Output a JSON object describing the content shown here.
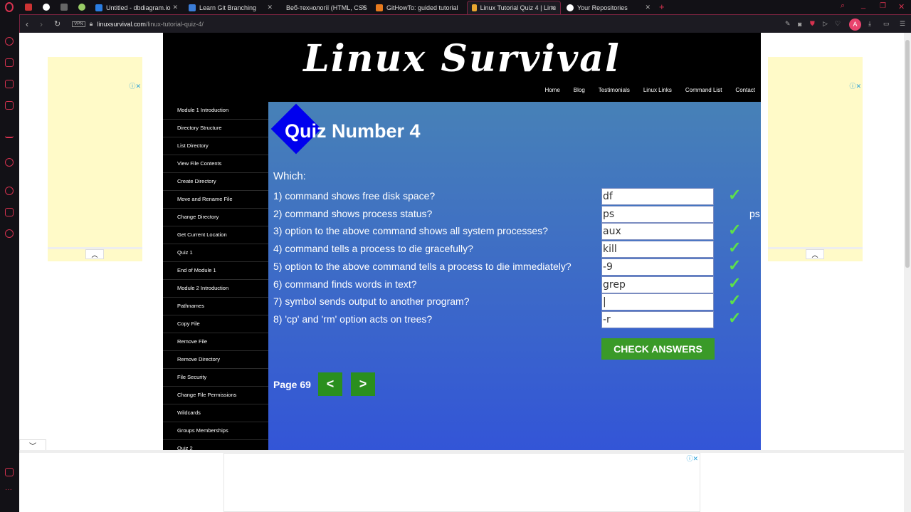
{
  "browser": {
    "tabs": [
      {
        "label": "Untitled - dbdiagram.io"
      },
      {
        "label": "Learn Git Branching"
      },
      {
        "label": "Веб-технології (HTML, CSS"
      },
      {
        "label": "GitHowTo: guided tutorial"
      },
      {
        "label": "Linux Tutorial Quiz 4 | Linu"
      },
      {
        "label": "Your Repositories"
      }
    ],
    "vpn": "VPN",
    "url_domain": "linuxsurvival.com",
    "url_path": "/linux-tutorial-quiz-4/",
    "avatar": "A"
  },
  "site": {
    "logo": "Linux Survival",
    "nav": [
      "Home",
      "Blog",
      "Testimonials",
      "Linux Links",
      "Command List",
      "Contact"
    ],
    "sidebar": [
      "Module 1 Introduction",
      "Directory Structure",
      "List Directory",
      "View File Contents",
      "Create Directory",
      "Move and Rename File",
      "Change Directory",
      "Get Current Location",
      "Quiz 1",
      "End of Module 1",
      "Module 2 Introduction",
      "Pathnames",
      "Copy File",
      "Remove File",
      "Remove Directory",
      "File Security",
      "Change File Permissions",
      "Wildcards",
      "Groups Memberships",
      "Quiz 2"
    ]
  },
  "quiz": {
    "title": "Quiz Number 4",
    "intro": "Which:",
    "questions": [
      {
        "q": "1) command shows free disk space?",
        "a": "df",
        "correct": true
      },
      {
        "q": "2) command shows process status?",
        "a": "ps",
        "correct": false,
        "hint": "ps"
      },
      {
        "q": "3) option to the above command shows all system processes?",
        "a": "aux",
        "correct": true
      },
      {
        "q": "4) command tells a process to die gracefully?",
        "a": "kill",
        "correct": true
      },
      {
        "q": "5) option to the above command tells a process to die immediately?",
        "a": "-9",
        "correct": true
      },
      {
        "q": "6) command finds words in text?",
        "a": "grep",
        "correct": true
      },
      {
        "q": "7) symbol sends output to another program?",
        "a": "|",
        "correct": true
      },
      {
        "q": "8) 'cp' and 'rm' option acts on trees?",
        "a": "-r",
        "correct": true
      }
    ],
    "check_label": "CHECK ANSWERS",
    "page_label": "Page 69",
    "prev": "<",
    "next": ">",
    "checkmark": "✓"
  },
  "colors": {
    "main_top": "#4781b7",
    "main_bottom": "#3355d7",
    "button_green": "#3a9a28",
    "check_green": "#5de04a",
    "accent": "#d6324f"
  }
}
